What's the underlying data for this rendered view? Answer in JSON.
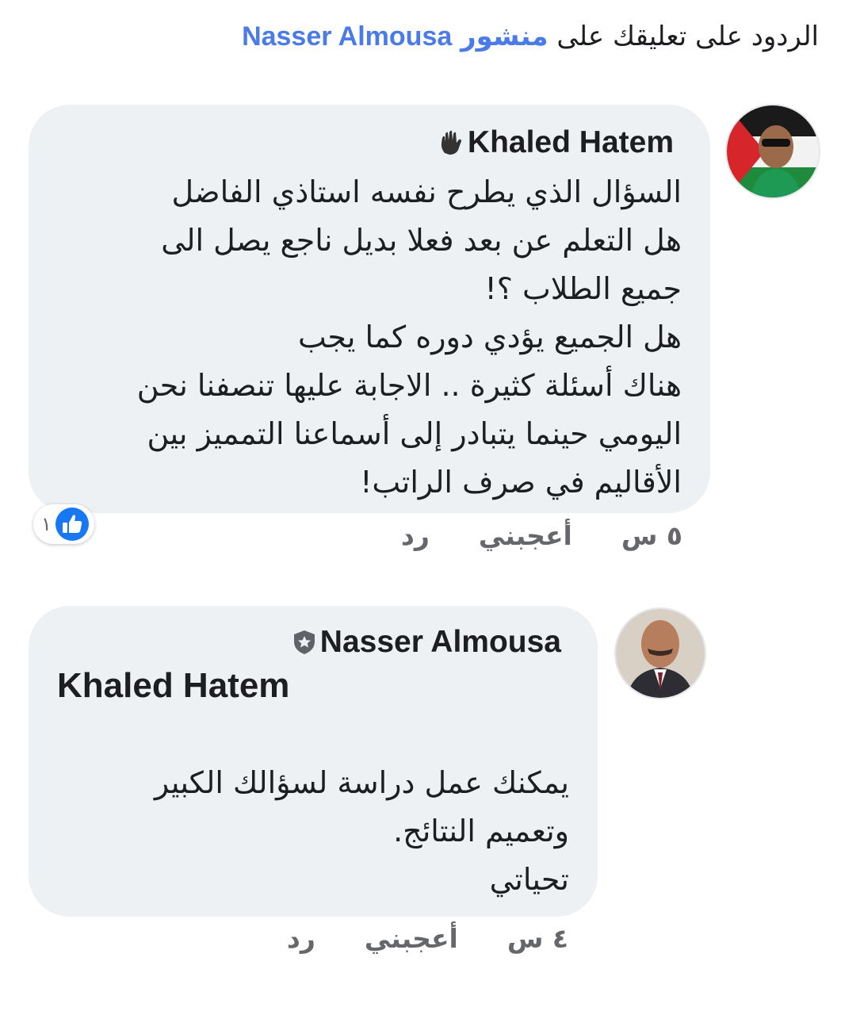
{
  "header": {
    "prefix": "الردود على تعليقك على",
    "link_word": "منشور",
    "post_author": "Nasser Almousa"
  },
  "comments": [
    {
      "author": "Khaled Hatem",
      "badge_icon": "raised-hand-icon",
      "text": "السؤال الذي يطرح نفسه استاذي الفاضل\nهل التعلم عن بعد فعلا بديل ناجع يصل الى\nجميع الطلاب ؟!\nهل الجميع يؤدي دوره كما يجب\nهناك أسئلة كثيرة .. الاجابة عليها تنصفنا نحن\nاليومي حينما يتبادر إلى أسماعنا التمميز بين\nالأقاليم في صرف الراتب!",
      "time": "٥ س",
      "like_label": "أعجبني",
      "reply_label": "رد",
      "reaction_count": "١",
      "reaction_icon": "like-thumb-icon"
    },
    {
      "author": "Nasser Almousa",
      "badge_icon": "shield-star-icon",
      "mention": "Khaled Hatem",
      "text": "يمكنك عمل دراسة لسؤالك الكبير\nوتعميم النتائج.\nتحياتي",
      "time": "٤ س",
      "like_label": "أعجبني",
      "reply_label": "رد"
    }
  ],
  "colors": {
    "link": "#4a7be6",
    "bubble": "#eef1f3",
    "meta": "#65676b",
    "like_blue": "#1877f2"
  }
}
